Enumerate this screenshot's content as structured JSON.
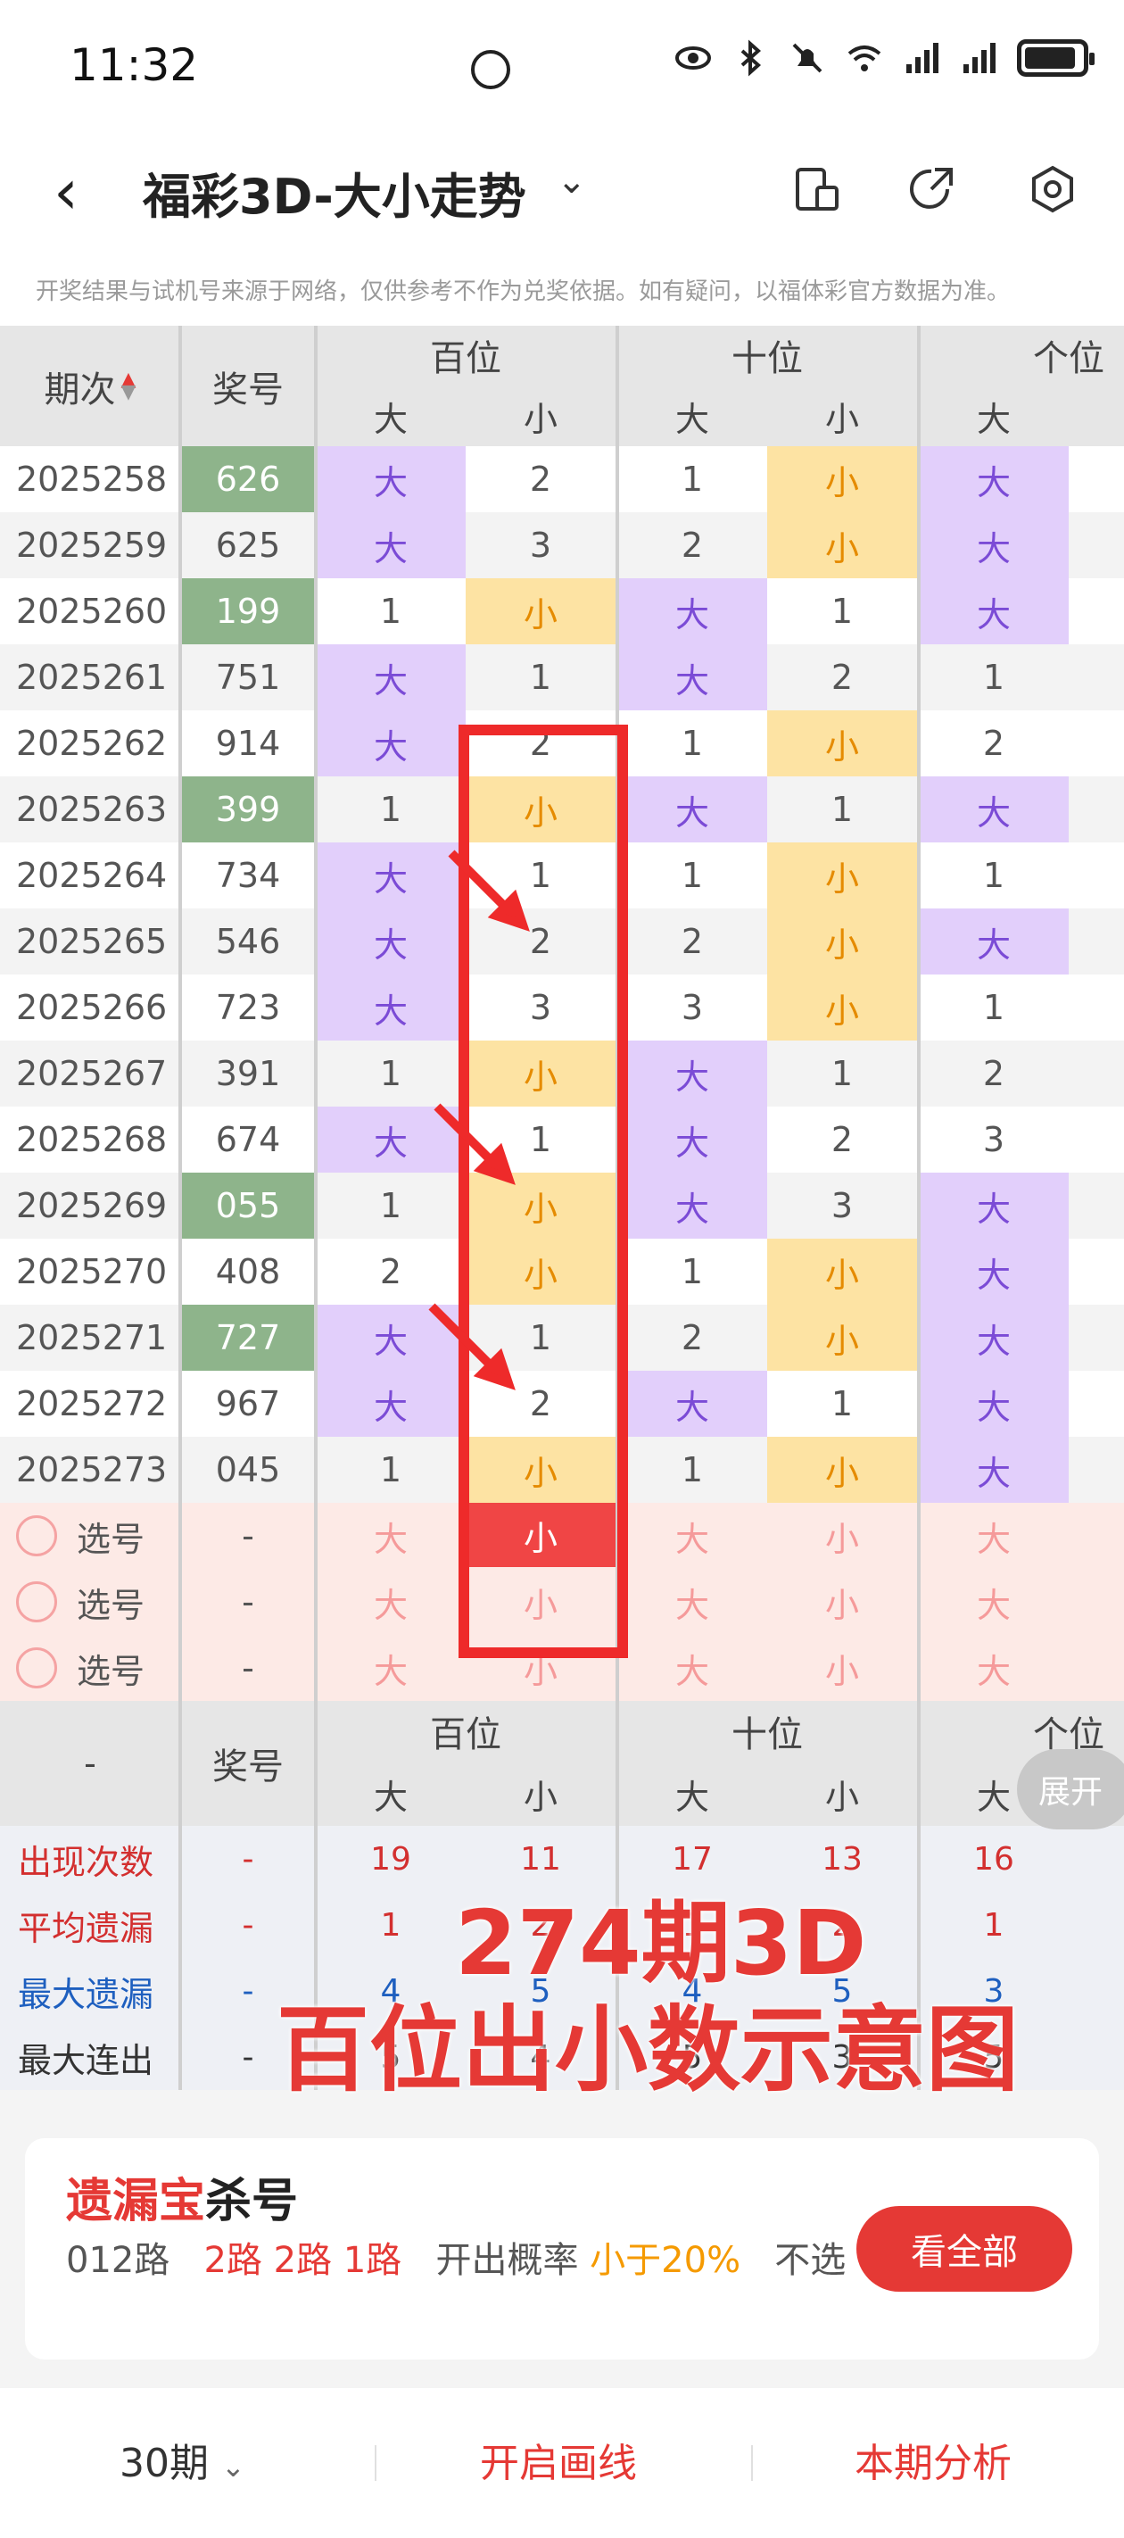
{
  "status_bar": {
    "time": "11:32"
  },
  "header": {
    "title": "福彩3D-大小走势"
  },
  "notice": "开奖结果与试机号来源于网络，仅供参考不作为兑奖依据。如有疑问，以福体彩官方数据为准。",
  "table": {
    "col_issue": "期次",
    "col_num": "奖号",
    "groups": [
      "百位",
      "十位",
      "个位"
    ],
    "sub": [
      "大",
      "小"
    ],
    "rows": [
      {
        "issue": "2025258",
        "num": "626",
        "hl": true,
        "b": [
          "大",
          "2"
        ],
        "s": [
          "1",
          "小"
        ],
        "g": "大"
      },
      {
        "issue": "2025259",
        "num": "625",
        "hl": false,
        "b": [
          "大",
          "3"
        ],
        "s": [
          "2",
          "小"
        ],
        "g": "大"
      },
      {
        "issue": "2025260",
        "num": "199",
        "hl": true,
        "b": [
          "1",
          "小"
        ],
        "s": [
          "大",
          "1"
        ],
        "g": "大"
      },
      {
        "issue": "2025261",
        "num": "751",
        "hl": false,
        "b": [
          "大",
          "1"
        ],
        "s": [
          "大",
          "2"
        ],
        "g": "1"
      },
      {
        "issue": "2025262",
        "num": "914",
        "hl": false,
        "b": [
          "大",
          "2"
        ],
        "s": [
          "1",
          "小"
        ],
        "g": "2"
      },
      {
        "issue": "2025263",
        "num": "399",
        "hl": true,
        "b": [
          "1",
          "小"
        ],
        "s": [
          "大",
          "1"
        ],
        "g": "大"
      },
      {
        "issue": "2025264",
        "num": "734",
        "hl": false,
        "b": [
          "大",
          "1"
        ],
        "s": [
          "1",
          "小"
        ],
        "g": "1"
      },
      {
        "issue": "2025265",
        "num": "546",
        "hl": false,
        "b": [
          "大",
          "2"
        ],
        "s": [
          "2",
          "小"
        ],
        "g": "大"
      },
      {
        "issue": "2025266",
        "num": "723",
        "hl": false,
        "b": [
          "大",
          "3"
        ],
        "s": [
          "3",
          "小"
        ],
        "g": "1"
      },
      {
        "issue": "2025267",
        "num": "391",
        "hl": false,
        "b": [
          "1",
          "小"
        ],
        "s": [
          "大",
          "1"
        ],
        "g": "2"
      },
      {
        "issue": "2025268",
        "num": "674",
        "hl": false,
        "b": [
          "大",
          "1"
        ],
        "s": [
          "大",
          "2"
        ],
        "g": "3"
      },
      {
        "issue": "2025269",
        "num": "055",
        "hl": true,
        "b": [
          "1",
          "小"
        ],
        "s": [
          "大",
          "3"
        ],
        "g": "大"
      },
      {
        "issue": "2025270",
        "num": "408",
        "hl": false,
        "b": [
          "2",
          "小"
        ],
        "s": [
          "1",
          "小"
        ],
        "g": "大"
      },
      {
        "issue": "2025271",
        "num": "727",
        "hl": true,
        "b": [
          "大",
          "1"
        ],
        "s": [
          "2",
          "小"
        ],
        "g": "大"
      },
      {
        "issue": "2025272",
        "num": "967",
        "hl": false,
        "b": [
          "大",
          "2"
        ],
        "s": [
          "大",
          "1"
        ],
        "g": "大"
      },
      {
        "issue": "2025273",
        "num": "045",
        "hl": false,
        "b": [
          "1",
          "小"
        ],
        "s": [
          "1",
          "小"
        ],
        "g": "大"
      }
    ],
    "pick_label": "选号",
    "pick_dash": "-",
    "pick_rows": 3
  },
  "stats": {
    "dash": "-",
    "num_label": "奖号",
    "expand": "展开",
    "rows": [
      {
        "label": "出现次数",
        "color": "#d32f2f",
        "vals": [
          "19",
          "11",
          "17",
          "13",
          "16"
        ]
      },
      {
        "label": "平均遗漏",
        "color": "#d32f2f",
        "vals": [
          "1",
          "2",
          "1",
          "2",
          "1"
        ]
      },
      {
        "label": "最大遗漏",
        "color": "#1e5fbf",
        "vals": [
          "4",
          "5",
          "4",
          "5",
          "3"
        ]
      },
      {
        "label": "最大连出",
        "color": "#333333",
        "vals": [
          "5",
          "4",
          "5",
          "3",
          "5"
        ]
      }
    ]
  },
  "overlay": {
    "line1": "274期3D",
    "line2": "百位出小数示意图"
  },
  "card": {
    "title_red": "遗漏宝",
    "title_black": "杀号",
    "route_label": "012路",
    "route_vals": "2路 2路 1路",
    "prob_label": "开出概率",
    "prob_val": "小于20%",
    "suffix": "不选",
    "button": "看全部"
  },
  "bottom": {
    "period": "30期",
    "draw": "开启画线",
    "analysis": "本期分析"
  },
  "colors": {
    "accent": "#e53935",
    "big": "#7b4bd6",
    "small": "#e58b00",
    "purple_bg": "#e2cffb",
    "yellow_bg": "#fde3a3",
    "green_num": "#8eb48b"
  }
}
